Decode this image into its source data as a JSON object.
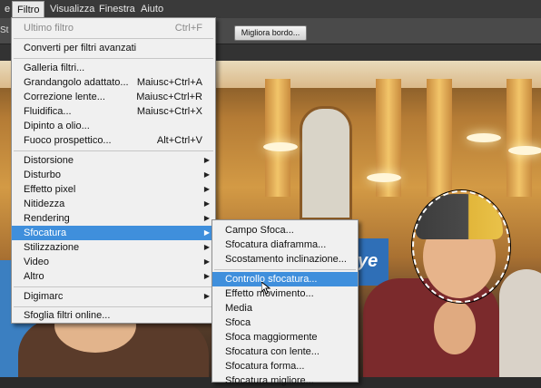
{
  "menubar": {
    "items": [
      "e",
      "Filtro",
      "Visualizza",
      "Finestra",
      "Aiuto"
    ]
  },
  "options_bar": {
    "edge_label": "St",
    "refine_edge_label": "Migliora bordo..."
  },
  "canvas": {
    "sign_text": "ye"
  },
  "filter_menu": {
    "last_filter": {
      "label": "Ultimo filtro",
      "shortcut": "Ctrl+F"
    },
    "convert_smart": "Converti per filtri avanzati",
    "filter_gallery": "Galleria filtri...",
    "adaptive_wide": {
      "label": "Grandangolo adattato...",
      "shortcut": "Maiusc+Ctrl+A"
    },
    "lens_correction": {
      "label": "Correzione lente...",
      "shortcut": "Maiusc+Ctrl+R"
    },
    "liquify": {
      "label": "Fluidifica...",
      "shortcut": "Maiusc+Ctrl+X"
    },
    "oil_paint": "Dipinto a olio...",
    "vanishing_point": {
      "label": "Fuoco prospettico...",
      "shortcut": "Alt+Ctrl+V"
    },
    "distort": "Distorsione",
    "noise": "Disturbo",
    "pixelate": "Effetto pixel",
    "sharpen": "Nitidezza",
    "render": "Rendering",
    "blur": "Sfocatura",
    "stylize": "Stilizzazione",
    "video": "Video",
    "other": "Altro",
    "digimarc": "Digimarc",
    "browse_online": "Sfoglia filtri online..."
  },
  "blur_submenu": {
    "items": [
      "Campo Sfoca...",
      "Sfocatura diaframma...",
      "Scostamento inclinazione...",
      "Controllo sfocatura...",
      "Effetto movimento...",
      "Media",
      "Sfoca",
      "Sfoca maggiormente",
      "Sfocatura con lente...",
      "Sfocatura forma...",
      "Sfocatura migliore..."
    ]
  }
}
